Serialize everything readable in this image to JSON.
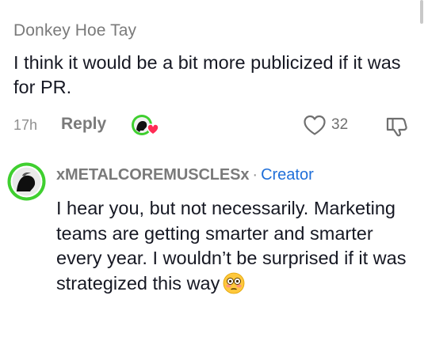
{
  "comment": {
    "author": "Donkey Hoe Tay",
    "text": "I think it would be a bit more publicized if it was for PR.",
    "time": "17h",
    "reply_label": "Reply",
    "like_count": "32"
  },
  "reply": {
    "author": "xMETALCOREMUSCLESx",
    "separator": "·",
    "badge": "Creator",
    "text": "I hear you, but not necessarily. Marketing teams are getting smarter and smarter every year. I wouldn’t be surprised if it was strategized this way"
  },
  "colors": {
    "accent": "#1f6fd9",
    "avatar_ring": "#3fcf2f",
    "heart": "#ff2c55",
    "muted": "#7a7a7a"
  },
  "icons": [
    "creator-liked-icon",
    "heart-outline-icon",
    "dislike-icon",
    "flushed-face-emoji-icon"
  ]
}
